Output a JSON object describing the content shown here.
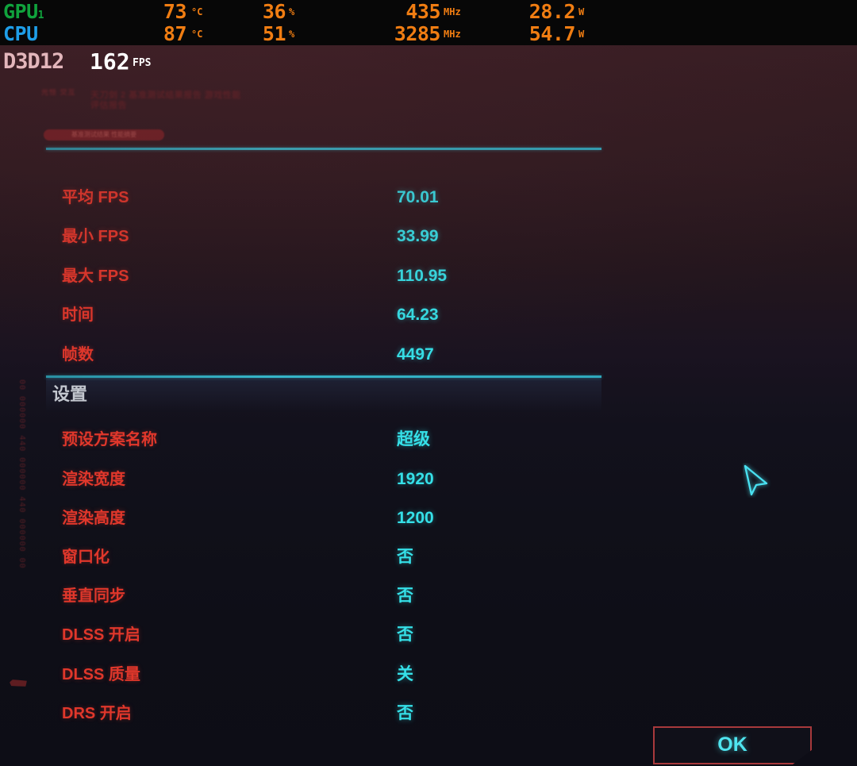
{
  "osd": {
    "rows": [
      {
        "tag": "GPU",
        "tag_sub": "1",
        "tag_color": "#10a23c",
        "metrics": [
          {
            "value": "73",
            "unit": "°C"
          },
          {
            "value": "36",
            "unit": "%"
          },
          {
            "value": "435",
            "unit": "MHz"
          },
          {
            "value": "28.2",
            "unit": "W"
          }
        ]
      },
      {
        "tag": "CPU",
        "tag_sub": "",
        "tag_color": "#1e9ee8",
        "metrics": [
          {
            "value": "87",
            "unit": "°C"
          },
          {
            "value": "51",
            "unit": "%"
          },
          {
            "value": "3285",
            "unit": "MHz"
          },
          {
            "value": "54.7",
            "unit": "W"
          }
        ]
      }
    ],
    "framerate": {
      "api": "D3D12",
      "value": "162",
      "unit": "FPS"
    },
    "value_color": "#f07d12"
  },
  "header": {
    "logo_mark": "光怪 交互",
    "logo_title": "天刀剑 2 基准测试结果报告  游戏性能评估报告",
    "bench_pill": "基准测试结果 性能摘要"
  },
  "results": {
    "rows": [
      {
        "label": "平均 FPS",
        "value": "70.01"
      },
      {
        "label": "最小 FPS",
        "value": "33.99"
      },
      {
        "label": "最大 FPS",
        "value": "110.95"
      },
      {
        "label": "时间",
        "value": "64.23"
      },
      {
        "label": "帧数",
        "value": "4497"
      }
    ]
  },
  "settings": {
    "title": "设置",
    "rows": [
      {
        "label": "预设方案名称",
        "value": "超级"
      },
      {
        "label": "渲染宽度",
        "value": "1920"
      },
      {
        "label": "渲染高度",
        "value": "1200"
      },
      {
        "label": "窗口化",
        "value": "否"
      },
      {
        "label": "垂直同步",
        "value": "否"
      },
      {
        "label": "DLSS 开启",
        "value": "否"
      },
      {
        "label": "DLSS 质量",
        "value": "关"
      },
      {
        "label": "DRS 开启",
        "value": "否"
      }
    ]
  },
  "footer": {
    "ok_label": "OK"
  },
  "decor": {
    "side_digits": "00 000000 440 000000 440 000000 00"
  },
  "colors": {
    "label_red": "#e0372b",
    "value_cyan": "#35e0e8",
    "divider_cyan": "#35b6c9",
    "ok_border_red": "#a8393c",
    "osd_orange": "#f07d12",
    "gpu_green": "#10a23c",
    "cpu_blue": "#1e9ee8"
  }
}
